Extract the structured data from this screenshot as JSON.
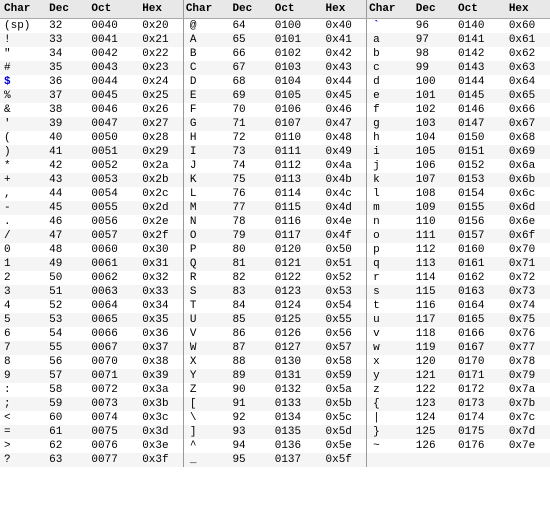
{
  "columns": [
    "Char",
    "Dec",
    "Oct",
    "Hex"
  ],
  "rows": [
    [
      [
        "(sp)",
        "32",
        "0040",
        "0x20"
      ],
      [
        "@",
        "64",
        "0100",
        "0x40"
      ],
      [
        "`",
        "96",
        "0140",
        "0x60"
      ]
    ],
    [
      [
        "!",
        "33",
        "0041",
        "0x21"
      ],
      [
        "A",
        "65",
        "0101",
        "0x41"
      ],
      [
        "a",
        "97",
        "0141",
        "0x61"
      ]
    ],
    [
      [
        "\"",
        "34",
        "0042",
        "0x22"
      ],
      [
        "B",
        "66",
        "0102",
        "0x42"
      ],
      [
        "b",
        "98",
        "0142",
        "0x62"
      ]
    ],
    [
      [
        "#",
        "35",
        "0043",
        "0x23"
      ],
      [
        "C",
        "67",
        "0103",
        "0x43"
      ],
      [
        "c",
        "99",
        "0143",
        "0x63"
      ]
    ],
    [
      [
        "$",
        "36",
        "0044",
        "0x24"
      ],
      [
        "D",
        "68",
        "0104",
        "0x44"
      ],
      [
        "d",
        "100",
        "0144",
        "0x64"
      ]
    ],
    [
      [
        "%",
        "37",
        "0045",
        "0x25"
      ],
      [
        "E",
        "69",
        "0105",
        "0x45"
      ],
      [
        "e",
        "101",
        "0145",
        "0x65"
      ]
    ],
    [
      [
        "&",
        "38",
        "0046",
        "0x26"
      ],
      [
        "F",
        "70",
        "0106",
        "0x46"
      ],
      [
        "f",
        "102",
        "0146",
        "0x66"
      ]
    ],
    [
      [
        "'",
        "39",
        "0047",
        "0x27"
      ],
      [
        "G",
        "71",
        "0107",
        "0x47"
      ],
      [
        "g",
        "103",
        "0147",
        "0x67"
      ]
    ],
    [
      [
        "(",
        "40",
        "0050",
        "0x28"
      ],
      [
        "H",
        "72",
        "0110",
        "0x48"
      ],
      [
        "h",
        "104",
        "0150",
        "0x68"
      ]
    ],
    [
      [
        ")",
        "41",
        "0051",
        "0x29"
      ],
      [
        "I",
        "73",
        "0111",
        "0x49"
      ],
      [
        "i",
        "105",
        "0151",
        "0x69"
      ]
    ],
    [
      [
        "*",
        "42",
        "0052",
        "0x2a"
      ],
      [
        "J",
        "74",
        "0112",
        "0x4a"
      ],
      [
        "j",
        "106",
        "0152",
        "0x6a"
      ]
    ],
    [
      [
        "+",
        "43",
        "0053",
        "0x2b"
      ],
      [
        "K",
        "75",
        "0113",
        "0x4b"
      ],
      [
        "k",
        "107",
        "0153",
        "0x6b"
      ]
    ],
    [
      [
        ",",
        "44",
        "0054",
        "0x2c"
      ],
      [
        "L",
        "76",
        "0114",
        "0x4c"
      ],
      [
        "l",
        "108",
        "0154",
        "0x6c"
      ]
    ],
    [
      [
        "-",
        "45",
        "0055",
        "0x2d"
      ],
      [
        "M",
        "77",
        "0115",
        "0x4d"
      ],
      [
        "m",
        "109",
        "0155",
        "0x6d"
      ]
    ],
    [
      [
        ".",
        "46",
        "0056",
        "0x2e"
      ],
      [
        "N",
        "78",
        "0116",
        "0x4e"
      ],
      [
        "n",
        "110",
        "0156",
        "0x6e"
      ]
    ],
    [
      [
        "/",
        "47",
        "0057",
        "0x2f"
      ],
      [
        "O",
        "79",
        "0117",
        "0x4f"
      ],
      [
        "o",
        "111",
        "0157",
        "0x6f"
      ]
    ],
    [
      [
        "0",
        "48",
        "0060",
        "0x30"
      ],
      [
        "P",
        "80",
        "0120",
        "0x50"
      ],
      [
        "p",
        "112",
        "0160",
        "0x70"
      ]
    ],
    [
      [
        "1",
        "49",
        "0061",
        "0x31"
      ],
      [
        "Q",
        "81",
        "0121",
        "0x51"
      ],
      [
        "q",
        "113",
        "0161",
        "0x71"
      ]
    ],
    [
      [
        "2",
        "50",
        "0062",
        "0x32"
      ],
      [
        "R",
        "82",
        "0122",
        "0x52"
      ],
      [
        "r",
        "114",
        "0162",
        "0x72"
      ]
    ],
    [
      [
        "3",
        "51",
        "0063",
        "0x33"
      ],
      [
        "S",
        "83",
        "0123",
        "0x53"
      ],
      [
        "s",
        "115",
        "0163",
        "0x73"
      ]
    ],
    [
      [
        "4",
        "52",
        "0064",
        "0x34"
      ],
      [
        "T",
        "84",
        "0124",
        "0x54"
      ],
      [
        "t",
        "116",
        "0164",
        "0x74"
      ]
    ],
    [
      [
        "5",
        "53",
        "0065",
        "0x35"
      ],
      [
        "U",
        "85",
        "0125",
        "0x55"
      ],
      [
        "u",
        "117",
        "0165",
        "0x75"
      ]
    ],
    [
      [
        "6",
        "54",
        "0066",
        "0x36"
      ],
      [
        "V",
        "86",
        "0126",
        "0x56"
      ],
      [
        "v",
        "118",
        "0166",
        "0x76"
      ]
    ],
    [
      [
        "7",
        "55",
        "0067",
        "0x37"
      ],
      [
        "W",
        "87",
        "0127",
        "0x57"
      ],
      [
        "w",
        "119",
        "0167",
        "0x77"
      ]
    ],
    [
      [
        "8",
        "56",
        "0070",
        "0x38"
      ],
      [
        "X",
        "88",
        "0130",
        "0x58"
      ],
      [
        "x",
        "120",
        "0170",
        "0x78"
      ]
    ],
    [
      [
        "9",
        "57",
        "0071",
        "0x39"
      ],
      [
        "Y",
        "89",
        "0131",
        "0x59"
      ],
      [
        "y",
        "121",
        "0171",
        "0x79"
      ]
    ],
    [
      [
        ":",
        "58",
        "0072",
        "0x3a"
      ],
      [
        "Z",
        "90",
        "0132",
        "0x5a"
      ],
      [
        "z",
        "122",
        "0172",
        "0x7a"
      ]
    ],
    [
      [
        ";",
        "59",
        "0073",
        "0x3b"
      ],
      [
        "[",
        "91",
        "0133",
        "0x5b"
      ],
      [
        "{",
        "123",
        "0173",
        "0x7b"
      ]
    ],
    [
      [
        "<",
        "60",
        "0074",
        "0x3c"
      ],
      [
        "\\",
        "92",
        "0134",
        "0x5c"
      ],
      [
        "|",
        "124",
        "0174",
        "0x7c"
      ]
    ],
    [
      [
        "=",
        "61",
        "0075",
        "0x3d"
      ],
      [
        "]",
        "93",
        "0135",
        "0x5d"
      ],
      [
        "}",
        "125",
        "0175",
        "0x7d"
      ]
    ],
    [
      [
        ">",
        "62",
        "0076",
        "0x3e"
      ],
      [
        "^",
        "94",
        "0136",
        "0x5e"
      ],
      [
        "~",
        "126",
        "0176",
        "0x7e"
      ]
    ],
    [
      [
        "?",
        "63",
        "0077",
        "0x3f"
      ],
      [
        "_",
        "95",
        "0137",
        "0x5f"
      ],
      [
        "",
        "",
        "",
        ""
      ]
    ]
  ]
}
